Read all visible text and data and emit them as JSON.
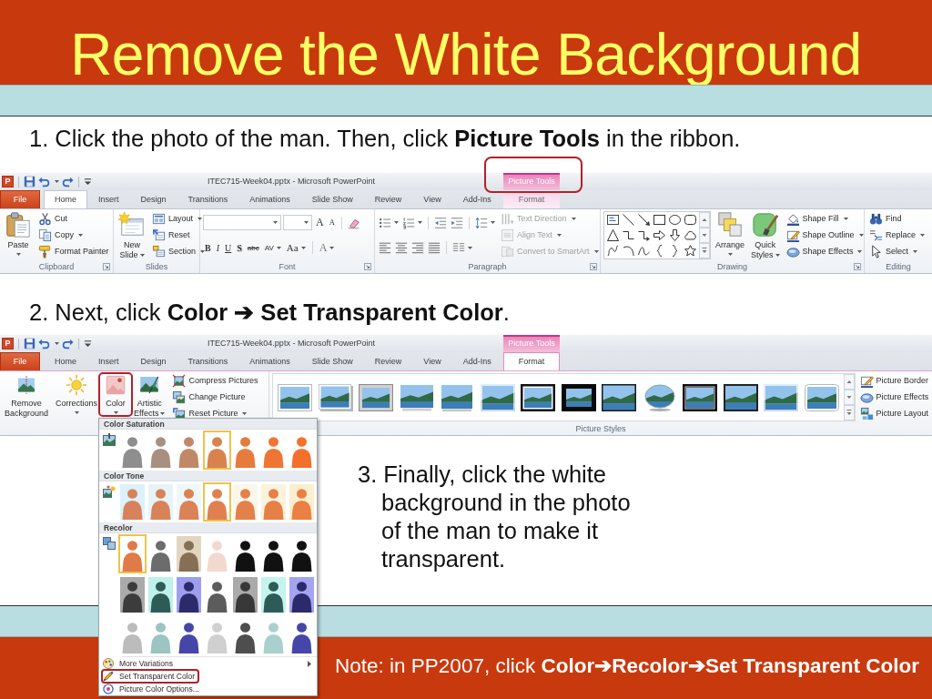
{
  "title": "Remove the White Background",
  "step_1": "1. Click the photo of the man. Then, click **Picture Tools** in the ribbon.",
  "ribbon_1": {
    "app_icon_label": "P",
    "window_title": "ITEC715-Week04.pptx - Microsoft PowerPoint",
    "contextual_tab": {
      "label": "Picture Tools",
      "circled": true
    },
    "tabs": [
      {
        "label": "File",
        "kind": "file",
        "selected": false
      },
      {
        "label": "Home",
        "kind": "standard",
        "selected": true
      },
      {
        "label": "Insert",
        "kind": "standard",
        "selected": false
      },
      {
        "label": "Design",
        "kind": "standard",
        "selected": false
      },
      {
        "label": "Transitions",
        "kind": "standard",
        "selected": false
      },
      {
        "label": "Animations",
        "kind": "standard",
        "selected": false
      },
      {
        "label": "Slide Show",
        "kind": "standard",
        "selected": false
      },
      {
        "label": "Review",
        "kind": "standard",
        "selected": false
      },
      {
        "label": "View",
        "kind": "standard",
        "selected": false
      },
      {
        "label": "Add-Ins",
        "kind": "standard",
        "selected": false
      },
      {
        "label": "Format",
        "kind": "contextual",
        "selected": false
      }
    ],
    "groups": [
      {
        "label": "Clipboard",
        "launcher": true,
        "columns": [
          [
            {
              "kind": "large",
              "label": "Paste",
              "dropdown": true
            }
          ],
          [
            {
              "kind": "small",
              "label": "Cut"
            },
            {
              "kind": "small",
              "label": "Copy",
              "dropdown": true
            },
            {
              "kind": "small",
              "label": "Format Painter"
            }
          ]
        ]
      },
      {
        "label": "Slides",
        "launcher": false,
        "columns": [
          [
            {
              "kind": "large",
              "label": "New Slide",
              "dropdown": true
            }
          ],
          [
            {
              "kind": "small",
              "label": "Layout",
              "dropdown": true
            },
            {
              "kind": "small",
              "label": "Reset"
            },
            {
              "kind": "small",
              "label": "Section",
              "dropdown": true
            }
          ]
        ]
      },
      {
        "label": "Font",
        "launcher": true,
        "columns": [
          [
            {
              "kind": "row",
              "items": [
                {
                  "kind": "field"
                },
                {
                  "kind": "field"
                },
                {
                  "kind": "text",
                  "label": "A"
                },
                {
                  "kind": "text",
                  "label": "A"
                },
                {
                  "kind": "separator"
                },
                {
                  "kind": "icon"
                }
              ]
            },
            {
              "kind": "row",
              "items": [
                {
                  "kind": "text",
                  "label": "B"
                },
                {
                  "kind": "text",
                  "label": "I"
                },
                {
                  "kind": "text",
                  "label": "U"
                },
                {
                  "kind": "text",
                  "label": "S"
                },
                {
                  "kind": "text",
                  "label": "abc"
                },
                {
                  "kind": "text",
                  "label": "AV",
                  "dropdown": true
                },
                {
                  "kind": "text",
                  "label": "Aa",
                  "dropdown": true
                },
                {
                  "kind": "separator"
                },
                {
                  "kind": "text",
                  "label": "A",
                  "dropdown": true
                }
              ]
            }
          ]
        ]
      },
      {
        "label": "Paragraph",
        "launcher": true,
        "columns": [
          [
            {
              "kind": "row",
              "items": [
                {
                  "kind": "icon",
                  "dropdown": true
                },
                {
                  "kind": "icon",
                  "dropdown": true
                },
                {
                  "kind": "separator"
                },
                {
                  "kind": "icon"
                },
                {
                  "kind": "icon"
                },
                {
                  "kind": "separator"
                },
                {
                  "kind": "icon",
                  "dropdown": true
                }
              ]
            },
            {
              "kind": "row",
              "items": [
                {
                  "kind": "icon"
                },
                {
                  "kind": "icon"
                },
                {
                  "kind": "icon"
                },
                {
                  "kind": "icon"
                },
                {
                  "kind": "separator"
                },
                {
                  "kind": "icon",
                  "dropdown": true
                }
              ]
            }
          ],
          [
            {
              "kind": "small",
              "label": "Text Direction",
              "dropdown": true,
              "disabled": true
            },
            {
              "kind": "small",
              "label": "Align Text",
              "dropdown": true,
              "disabled": true
            },
            {
              "kind": "small",
              "label": "Convert to SmartArt",
              "dropdown": true,
              "disabled": true
            }
          ]
        ]
      },
      {
        "label": "Drawing",
        "launcher": true,
        "columns": [
          [
            {
              "kind": "shapes"
            }
          ],
          [
            {
              "kind": "large",
              "label": "Arrange",
              "dropdown": true
            }
          ],
          [
            {
              "kind": "large",
              "label": "Quick Styles",
              "dropdown": true
            }
          ],
          [
            {
              "kind": "small",
              "label": "Shape Fill",
              "dropdown": true
            },
            {
              "kind": "small",
              "label": "Shape Outline",
              "dropdown": true
            },
            {
              "kind": "small",
              "label": "Shape Effects",
              "dropdown": true
            }
          ]
        ]
      },
      {
        "label": "Editing",
        "launcher": false,
        "columns": [
          [
            {
              "kind": "small",
              "label": "Find"
            },
            {
              "kind": "small",
              "label": "Replace",
              "dropdown": true
            },
            {
              "kind": "small",
              "label": "Select",
              "dropdown": true
            }
          ]
        ]
      }
    ]
  },
  "step_2": "2. Next, click **Color ➔ Set Transparent Color**.",
  "ribbon_2": {
    "app_icon_label": "P",
    "window_title": "ITEC715-Week04.pptx - Microsoft PowerPoint",
    "contextual_tab": {
      "label": "Picture Tools"
    },
    "tabs": [
      {
        "label": "File",
        "kind": "file",
        "selected": false
      },
      {
        "label": "Home",
        "kind": "standard",
        "selected": false
      },
      {
        "label": "Insert",
        "kind": "standard",
        "selected": false
      },
      {
        "label": "Design",
        "kind": "standard",
        "selected": false
      },
      {
        "label": "Transitions",
        "kind": "standard",
        "selected": false
      },
      {
        "label": "Animations",
        "kind": "standard",
        "selected": false
      },
      {
        "label": "Slide Show",
        "kind": "standard",
        "selected": false
      },
      {
        "label": "Review",
        "kind": "standard",
        "selected": false
      },
      {
        "label": "View",
        "kind": "standard",
        "selected": false
      },
      {
        "label": "Add-Ins",
        "kind": "standard",
        "selected": false
      },
      {
        "label": "Format",
        "kind": "contextual",
        "selected": true
      }
    ],
    "groups": [
      {
        "columns": [
          [
            {
              "kind": "large",
              "label": "Remove Background"
            }
          ],
          [
            {
              "kind": "large",
              "label": "Corrections",
              "dropdown": true
            }
          ],
          [
            {
              "kind": "large",
              "label": "Color",
              "dropdown": true,
              "circled": true
            }
          ],
          [
            {
              "kind": "large",
              "label": "Artistic Effects",
              "dropdown": true
            }
          ],
          [
            {
              "kind": "small",
              "label": "Compress Pictures"
            },
            {
              "kind": "small",
              "label": "Change Picture"
            },
            {
              "kind": "small",
              "label": "Reset Picture",
              "dropdown": true
            }
          ]
        ]
      },
      {
        "label": "Picture Styles",
        "columns": [
          [
            {
              "kind": "styles",
              "items": [
                {
                  "kind": "frame",
                  "selected": false
                },
                {
                  "kind": "shadowed",
                  "selected": false
                },
                {
                  "kind": "metal",
                  "selected": false
                },
                {
                  "kind": "drop",
                  "selected": false
                },
                {
                  "kind": "tilted",
                  "selected": false
                },
                {
                  "kind": "soft",
                  "selected": false
                },
                {
                  "kind": "double",
                  "selected": false
                },
                {
                  "kind": "thick",
                  "selected": false
                },
                {
                  "kind": "outlined",
                  "selected": false
                },
                {
                  "kind": "oval",
                  "selected": false
                },
                {
                  "kind": "matte",
                  "selected": false
                },
                {
                  "kind": "thin",
                  "selected": false
                },
                {
                  "kind": "feathered",
                  "selected": false
                },
                {
                  "kind": "rounded",
                  "selected": false
                }
              ]
            }
          ],
          [
            {
              "kind": "small",
              "label": "Picture Border"
            },
            {
              "kind": "small",
              "label": "Picture Effects"
            },
            {
              "kind": "small",
              "label": "Picture Layout"
            }
          ]
        ]
      }
    ]
  },
  "color_menu": {
    "sections": [
      {
        "heading": "Color Saturation",
        "rows": [
          [
            {
              "selected": false,
              "figure": {
                "color": "#8e8e8e"
              },
              "backdrop": {
                "color": "#ffffff"
              }
            },
            {
              "selected": false,
              "figure": {
                "color": "#a98f80"
              },
              "backdrop": {
                "color": "#ffffff"
              }
            },
            {
              "selected": false,
              "figure": {
                "color": "#c18868"
              },
              "backdrop": {
                "color": "#ffffff"
              }
            },
            {
              "selected": true,
              "figure": {
                "color": "#d9824f"
              },
              "backdrop": {
                "color": "#ffffff"
              }
            },
            {
              "selected": false,
              "figure": {
                "color": "#e67b3e"
              },
              "backdrop": {
                "color": "#ffffff"
              }
            },
            {
              "selected": false,
              "figure": {
                "color": "#ee7533"
              },
              "backdrop": {
                "color": "#ffffff"
              }
            },
            {
              "selected": false,
              "figure": {
                "color": "#f3702b"
              },
              "backdrop": {
                "color": "#ffffff"
              }
            }
          ]
        ]
      },
      {
        "heading": "Color Tone",
        "rows": [
          [
            {
              "selected": false,
              "figure": {
                "color": "#d6825c"
              },
              "backdrop": {
                "color": "#dcf1fb"
              }
            },
            {
              "selected": false,
              "figure": {
                "color": "#d88259"
              },
              "backdrop": {
                "color": "#e6f4fa"
              }
            },
            {
              "selected": false,
              "figure": {
                "color": "#db8256"
              },
              "backdrop": {
                "color": "#f0f7fa"
              }
            },
            {
              "selected": true,
              "figure": {
                "color": "#e08050"
              },
              "backdrop": {
                "color": "#ffffff"
              }
            },
            {
              "selected": false,
              "figure": {
                "color": "#e4804b"
              },
              "backdrop": {
                "color": "#fcf7ea"
              }
            },
            {
              "selected": false,
              "figure": {
                "color": "#e78047"
              },
              "backdrop": {
                "color": "#fcf3dc"
              }
            },
            {
              "selected": false,
              "figure": {
                "color": "#ea8043"
              },
              "backdrop": {
                "color": "#fbefcf"
              }
            }
          ]
        ]
      },
      {
        "heading": "Recolor",
        "rows": [
          [
            {
              "selected": true,
              "figure": {
                "color": "#e07a48"
              },
              "backdrop": {
                "color": "#ffffff"
              }
            },
            {
              "selected": false,
              "figure": {
                "color": "#6c6c6c"
              },
              "backdrop": {
                "color": "#ffffff"
              }
            },
            {
              "selected": false,
              "figure": {
                "color": "#857056"
              },
              "backdrop": {
                "color": "#e3d6c0"
              }
            },
            {
              "selected": false,
              "figure": {
                "color": "#f2d9cf"
              },
              "backdrop": {
                "color": "#ffffff"
              }
            },
            {
              "selected": false,
              "figure": {
                "color": "#111111"
              },
              "backdrop": {
                "color": "#ffffff"
              }
            },
            {
              "selected": false,
              "figure": {
                "color": "#111111"
              },
              "backdrop": {
                "color": "#ffffff"
              }
            },
            {
              "selected": false,
              "figure": {
                "color": "#111111"
              },
              "backdrop": {
                "color": "#ffffff"
              }
            }
          ],
          [
            {
              "selected": false,
              "figure": {
                "color": "#3c3c3c"
              },
              "backdrop": {
                "color": "#aaaaaa"
              }
            },
            {
              "selected": false,
              "figure": {
                "color": "#2d5b57"
              },
              "backdrop": {
                "color": "#bdf1ea"
              }
            },
            {
              "selected": false,
              "figure": {
                "color": "#2b2b6b"
              },
              "backdrop": {
                "color": "#9e9ef0"
              }
            },
            {
              "selected": false,
              "figure": {
                "color": "#5c5c5c"
              },
              "backdrop": {
                "color": "#ffffff"
              }
            },
            {
              "selected": false,
              "figure": {
                "color": "#383838"
              },
              "backdrop": {
                "color": "#aaaaaa"
              }
            },
            {
              "selected": false,
              "figure": {
                "color": "#2d5b57"
              },
              "backdrop": {
                "color": "#c4f4ee"
              }
            },
            {
              "selected": false,
              "figure": {
                "color": "#2b2b6b"
              },
              "backdrop": {
                "color": "#a4a4f0"
              }
            }
          ],
          [
            {
              "selected": false,
              "figure": {
                "color": "#bcbcbc"
              },
              "backdrop": {
                "color": "#ffffff"
              }
            },
            {
              "selected": false,
              "figure": {
                "color": "#9cc4c0"
              },
              "backdrop": {
                "color": "#ffffff"
              }
            },
            {
              "selected": false,
              "figure": {
                "color": "#4646a8"
              },
              "backdrop": {
                "color": "#ffffff"
              }
            },
            {
              "selected": false,
              "figure": {
                "color": "#d0d0d0"
              },
              "backdrop": {
                "color": "#ffffff"
              }
            },
            {
              "selected": false,
              "figure": {
                "color": "#4e4e4e"
              },
              "backdrop": {
                "color": "#ffffff"
              }
            },
            {
              "selected": false,
              "figure": {
                "color": "#a9d0cc"
              },
              "backdrop": {
                "color": "#ffffff"
              }
            },
            {
              "selected": false,
              "figure": {
                "color": "#4646a8"
              },
              "backdrop": {
                "color": "#ffffff"
              }
            }
          ]
        ]
      }
    ],
    "items": [
      {
        "label": "More Variations",
        "submenu": true
      },
      {
        "label": "Set Transparent Color",
        "circled": true
      },
      {
        "label": "Picture Color Options..."
      }
    ]
  },
  "step_3": "3. Finally, click the white background in the photo of the man to make it transparent.",
  "note": "Note: in PP2007, click **Color➔Recolor➔Set Transparent Color**"
}
